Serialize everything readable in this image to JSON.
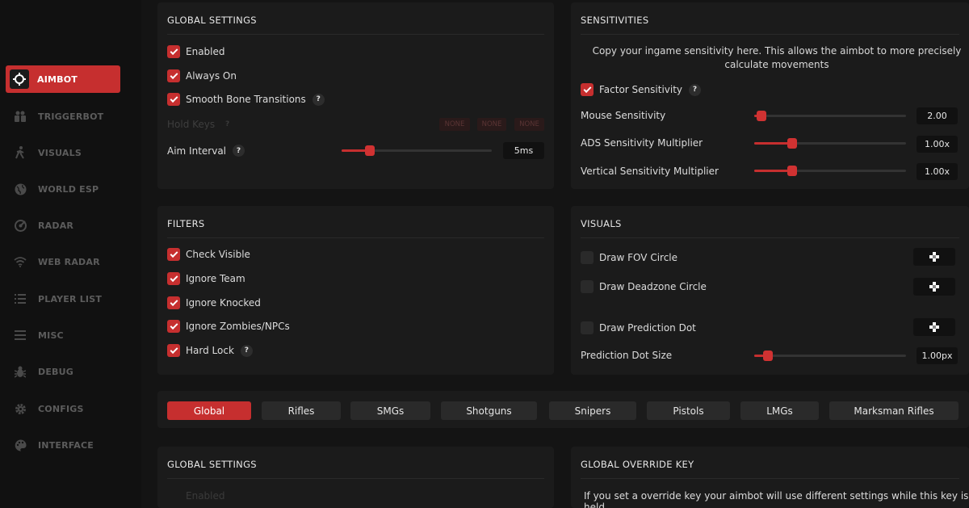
{
  "sidebar": {
    "items": [
      {
        "label": "AIMBOT",
        "icon": "crosshair-icon",
        "active": true
      },
      {
        "label": "TRIGGERBOT",
        "icon": "group-icon"
      },
      {
        "label": "VISUALS",
        "icon": "walking-person-icon"
      },
      {
        "label": "WORLD ESP",
        "icon": "globe-icon"
      },
      {
        "label": "RADAR",
        "icon": "radar-icon"
      },
      {
        "label": "WEB RADAR",
        "icon": "wifi-icon"
      },
      {
        "label": "PLAYER LIST",
        "icon": "list-icon"
      },
      {
        "label": "MISC",
        "icon": "menu-icon"
      },
      {
        "label": "DEBUG",
        "icon": "bug-icon"
      },
      {
        "label": "CONFIGS",
        "icon": "gear-icon"
      },
      {
        "label": "INTERFACE",
        "icon": "palette-icon"
      }
    ]
  },
  "global_settings": {
    "title": "GLOBAL SETTINGS",
    "enabled": "Enabled",
    "always_on": "Always On",
    "smooth_bone": "Smooth Bone Transitions",
    "hold_keys": "Hold Keys",
    "keys": [
      "NONE",
      "NONE",
      "NONE"
    ],
    "aim_interval": "Aim Interval",
    "aim_interval_value": "5ms",
    "aim_interval_fraction": 0.19
  },
  "sensitivities": {
    "title": "SENSITIVITIES",
    "description": "Copy your ingame sensitivity here. This allows the aimbot to more precisely calculate movements",
    "factor": "Factor Sensitivity",
    "mouse": "Mouse Sensitivity",
    "mouse_value": "2.00",
    "mouse_fraction": 0.05,
    "ads": "ADS Sensitivity Multiplier",
    "ads_value": "1.00x",
    "ads_fraction": 0.25,
    "vertical": "Vertical Sensitivity Multiplier",
    "vertical_value": "1.00x",
    "vertical_fraction": 0.25
  },
  "filters": {
    "title": "FILTERS",
    "items": [
      "Check Visible",
      "Ignore Team",
      "Ignore Knocked",
      "Ignore Zombies/NPCs",
      "Hard Lock"
    ]
  },
  "visuals": {
    "title": "VISUALS",
    "fov": "Draw FOV Circle",
    "deadzone": "Draw Deadzone Circle",
    "prediction": "Draw Prediction Dot",
    "dot_size": "Prediction Dot Size",
    "dot_size_value": "1.00px",
    "dot_size_fraction": 0.09
  },
  "weapon_tabs": [
    "Global",
    "Rifles",
    "SMGs",
    "Shotguns",
    "Snipers",
    "Pistols",
    "LMGs",
    "Marksman Rifles"
  ],
  "global_settings_2": {
    "title": "GLOBAL SETTINGS",
    "enabled": "Enabled"
  },
  "override": {
    "title": "GLOBAL OVERRIDE KEY",
    "text": "If you set a override key your aimbot will use different settings while this key is held"
  },
  "help_glyph": "?",
  "colors": {
    "accent": "#c62f2f",
    "panel": "#1b1b1b",
    "background": "#141414"
  }
}
